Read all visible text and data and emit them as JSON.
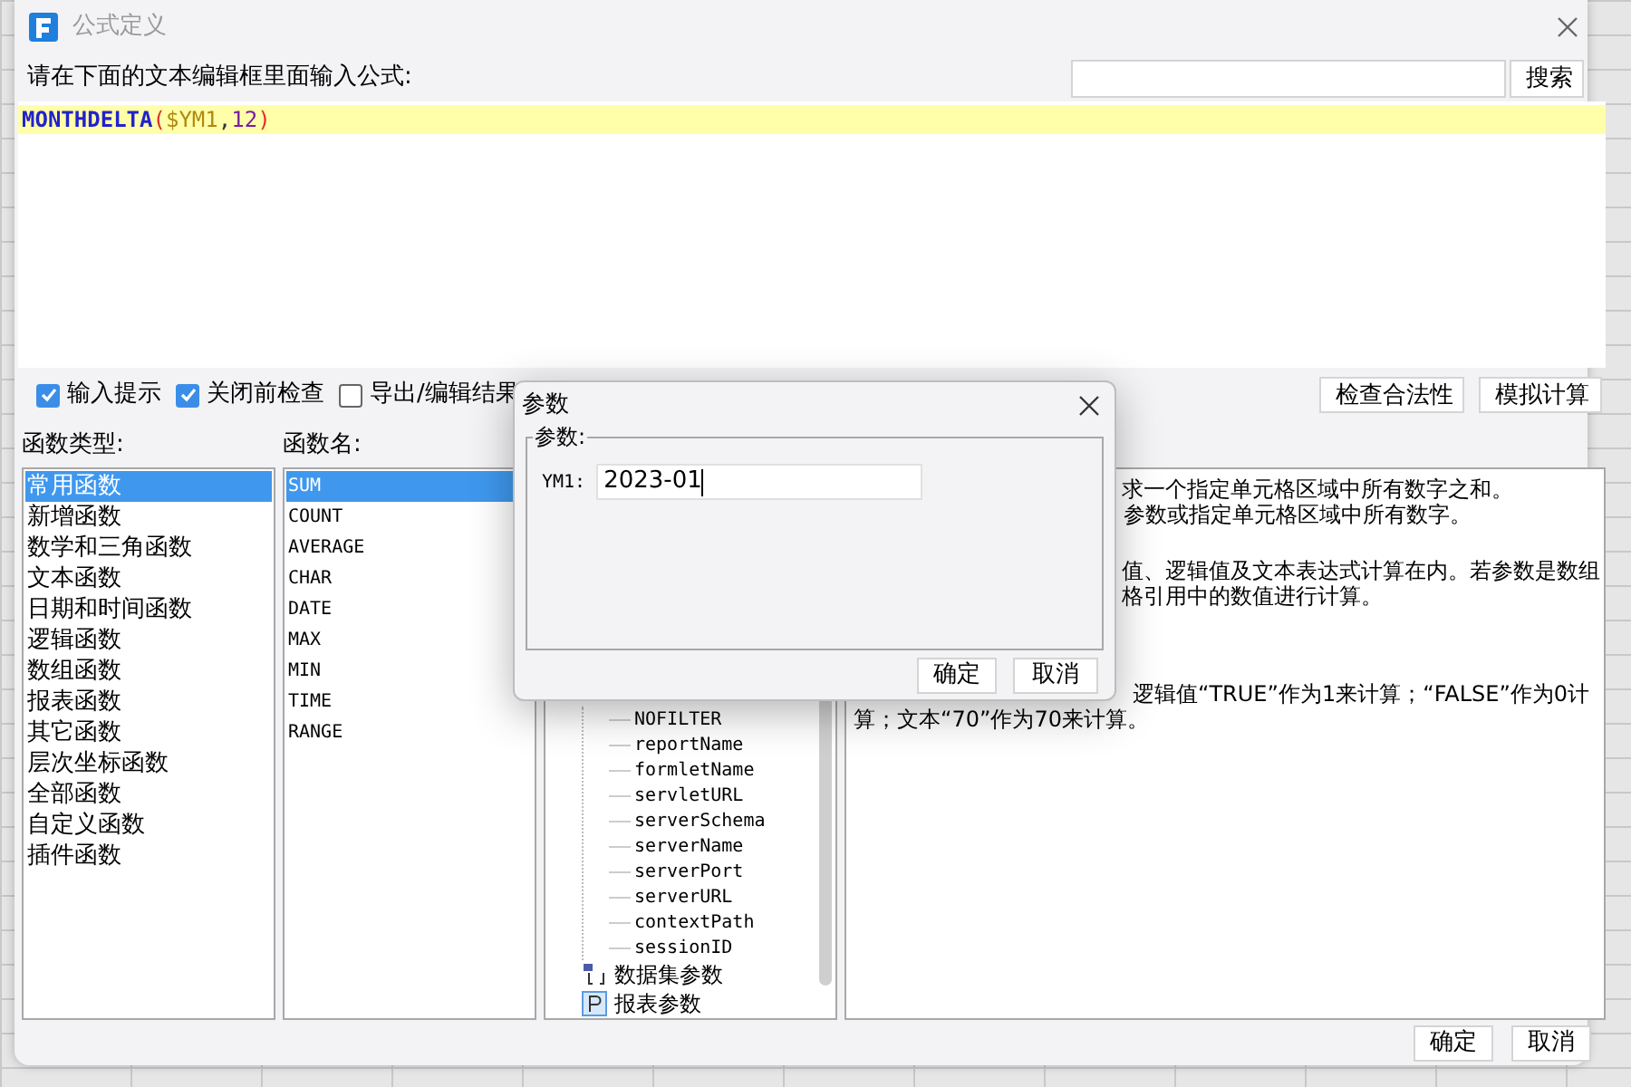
{
  "window": {
    "title": "公式定义"
  },
  "prompt": "请在下面的文本编辑框里面输入公式:",
  "search": {
    "button": "搜索"
  },
  "formula": {
    "tokens": [
      {
        "text": "MONTHDELTA",
        "kind": "function"
      },
      {
        "text": "(",
        "kind": "paren"
      },
      {
        "text": "$YM1",
        "kind": "param"
      },
      {
        "text": ",",
        "kind": "comma"
      },
      {
        "text": "12",
        "kind": "number"
      },
      {
        "text": ")",
        "kind": "paren"
      }
    ]
  },
  "options": [
    {
      "label": "输入提示",
      "checked": true
    },
    {
      "label": "关闭前检查",
      "checked": true
    },
    {
      "label": "导出/编辑结果",
      "checked": false
    }
  ],
  "tool_buttons": [
    "检查合法性",
    "模拟计算"
  ],
  "categories": {
    "label": "函数类型:",
    "items": [
      {
        "label": "常用函数",
        "selected": true
      },
      {
        "label": "新增函数",
        "selected": false
      },
      {
        "label": "数学和三角函数",
        "selected": false
      },
      {
        "label": "文本函数",
        "selected": false
      },
      {
        "label": "日期和时间函数",
        "selected": false
      },
      {
        "label": "逻辑函数",
        "selected": false
      },
      {
        "label": "数组函数",
        "selected": false
      },
      {
        "label": "报表函数",
        "selected": false
      },
      {
        "label": "其它函数",
        "selected": false
      },
      {
        "label": "层次坐标函数",
        "selected": false
      },
      {
        "label": "全部函数",
        "selected": false
      },
      {
        "label": "自定义函数",
        "selected": false
      },
      {
        "label": "插件函数",
        "selected": false
      }
    ]
  },
  "functions": {
    "label": "函数名:",
    "items": [
      {
        "label": "SUM",
        "selected": true
      },
      {
        "label": "COUNT",
        "selected": false
      },
      {
        "label": "AVERAGE",
        "selected": false
      },
      {
        "label": "CHAR",
        "selected": false
      },
      {
        "label": "DATE",
        "selected": false
      },
      {
        "label": "MAX",
        "selected": false
      },
      {
        "label": "MIN",
        "selected": false
      },
      {
        "label": "TIME",
        "selected": false
      },
      {
        "label": "RANGE",
        "selected": false
      }
    ]
  },
  "tree": [
    {
      "kind": "group",
      "children": [
        {
          "label": "NOFILTER"
        },
        {
          "label": "reportName"
        },
        {
          "label": "formletName"
        },
        {
          "label": "servletURL"
        },
        {
          "label": "serverSchema"
        },
        {
          "label": "serverName"
        },
        {
          "label": "serverPort"
        },
        {
          "label": "serverURL"
        },
        {
          "label": "contextPath"
        },
        {
          "label": "sessionID"
        }
      ]
    },
    {
      "kind": "dataset",
      "label": "数据集参数"
    },
    {
      "kind": "report_param",
      "label": "报表参数"
    }
  ],
  "description": [
    {
      "text": "求一个指定单元格区域中所有数字之和。",
      "kind": "covered"
    },
    {
      "text": "参数或指定单元格区域中所有数字。",
      "kind": "covered"
    },
    {
      "text": "值、逻辑值及文本表达式计算在内。若参数是数组",
      "kind": "covered"
    },
    {
      "text": "格引用中的数值进行计算。",
      "kind": "covered"
    },
    {
      "text": "逻辑值“TRUE”作为1来计算；“FALSE”作为0计",
      "kind": "covered"
    },
    {
      "text": "算；文本“70”作为70来计算。",
      "kind": "full"
    }
  ],
  "buttons": [
    "确定",
    "取消"
  ],
  "param_dialog": {
    "title": "参数",
    "group": "参数:",
    "fields": [
      {
        "label": "YM1:",
        "value": "2023-01"
      }
    ],
    "buttons": [
      "确定",
      "取消"
    ]
  }
}
